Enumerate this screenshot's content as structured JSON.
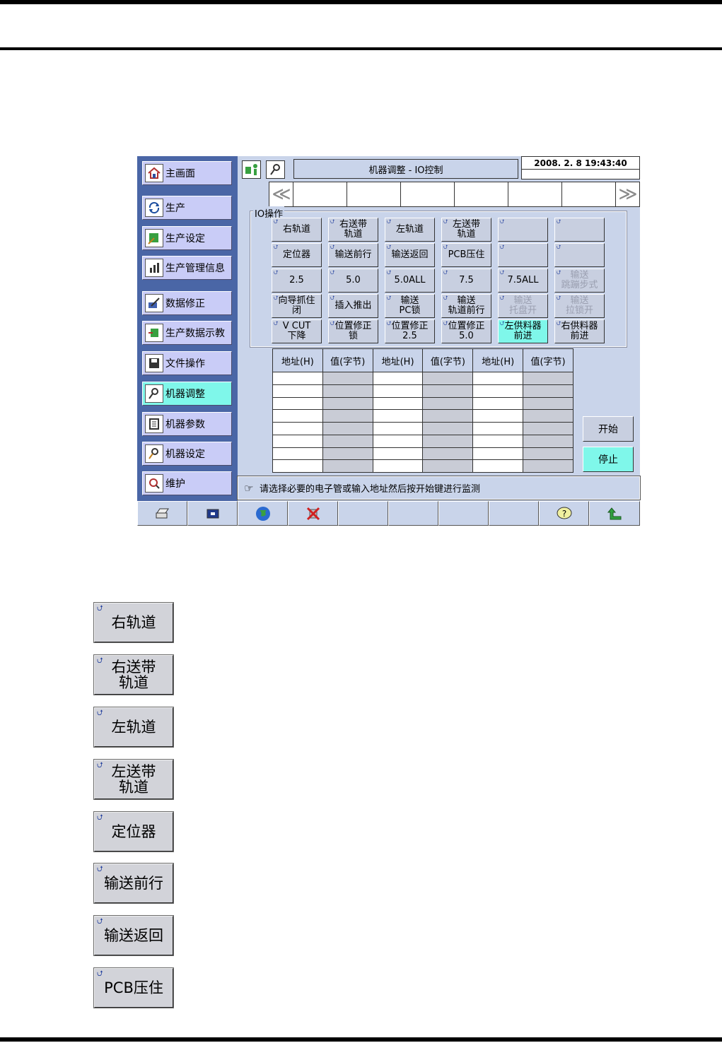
{
  "window": {
    "title": "机器调整 - IO控制",
    "datetime": "2008. 2. 8 19:43:40"
  },
  "sidebar": {
    "items": [
      {
        "label": "主画面",
        "icon": "home-icon"
      },
      {
        "label": "生产",
        "icon": "production-cycle-icon"
      },
      {
        "label": "生产设定",
        "icon": "production-setup-icon"
      },
      {
        "label": "生产管理信息",
        "icon": "production-stats-icon"
      },
      {
        "label": "数据修正",
        "icon": "data-edit-icon"
      },
      {
        "label": "生产数据示教",
        "icon": "teaching-icon"
      },
      {
        "label": "文件操作",
        "icon": "floppy-disk-icon"
      },
      {
        "label": "机器调整",
        "icon": "machine-adjust-icon",
        "active": true
      },
      {
        "label": "机器参数",
        "icon": "machine-parameter-icon"
      },
      {
        "label": "机器设定",
        "icon": "machine-setting-icon"
      },
      {
        "label": "维护",
        "icon": "maintenance-icon"
      }
    ]
  },
  "io_group": {
    "legend": "IO操作",
    "rows": [
      [
        {
          "l1": "右轨道"
        },
        {
          "l1": "右送带",
          "l2": "轨道"
        },
        {
          "l1": "左轨道"
        },
        {
          "l1": "左送带",
          "l2": "轨道"
        },
        {
          "l1": ""
        },
        {
          "l1": ""
        }
      ],
      [
        {
          "l1": "定位器"
        },
        {
          "l1": "输送前行"
        },
        {
          "l1": "输送返回"
        },
        {
          "l1": "PCB压住"
        },
        {
          "l1": ""
        },
        {
          "l1": ""
        }
      ],
      [
        {
          "l1": "2.5"
        },
        {
          "l1": "5.0"
        },
        {
          "l1": "5.0ALL"
        },
        {
          "l1": "7.5"
        },
        {
          "l1": "7.5ALL"
        },
        {
          "l1": "输送",
          "l2": "跳蹦步式",
          "disabled": true
        }
      ],
      [
        {
          "l1": "向导抓住",
          "l2": "闭"
        },
        {
          "l1": "插入推出"
        },
        {
          "l1": "输送",
          "l2": "PC锁"
        },
        {
          "l1": "输送",
          "l2": "轨道前行"
        },
        {
          "l1": "输送",
          "l2": "托盘开",
          "disabled": true
        },
        {
          "l1": "输送",
          "l2": "拉锁开",
          "disabled": true
        }
      ],
      [
        {
          "l1": "V CUT",
          "l2": "下降"
        },
        {
          "l1": "位置修正",
          "l2": "锁"
        },
        {
          "l1": "位置修正",
          "l2": "2.5"
        },
        {
          "l1": "位置修正",
          "l2": "5.0"
        },
        {
          "l1": "左供料器",
          "l2": "前进",
          "active": true
        },
        {
          "l1": "右供料器",
          "l2": "前进"
        }
      ]
    ]
  },
  "monitor_table": {
    "headers": [
      "地址(H)",
      "值(字节)",
      "地址(H)",
      "值(字节)",
      "地址(H)",
      "值(字节)"
    ],
    "row_count": 8
  },
  "controls": {
    "start_label": "开始",
    "stop_label": "停止"
  },
  "status": {
    "message": "请选择必要的电子管或输入地址然后按开始键进行监测"
  },
  "toolbar": {
    "items": [
      "printer-icon",
      "window-icon",
      "globe-icon",
      "cancel-x-icon",
      "",
      "",
      "",
      "",
      "help-icon",
      "return-arrow-icon"
    ]
  },
  "legend_buttons": [
    {
      "l1": "右轨道"
    },
    {
      "l1": "右送带",
      "l2": "轨道"
    },
    {
      "l1": "左轨道"
    },
    {
      "l1": "左送带",
      "l2": "轨道"
    },
    {
      "l1": "定位器"
    },
    {
      "l1": "输送前行"
    },
    {
      "l1": "输送返回"
    },
    {
      "l1": "PCB压住"
    }
  ],
  "colors": {
    "sidebar_bg": "#4a66a6",
    "nav_button": "#c9ccf7",
    "active_cyan": "#7ff7ea",
    "panel_bg": "#c9d4ea"
  }
}
